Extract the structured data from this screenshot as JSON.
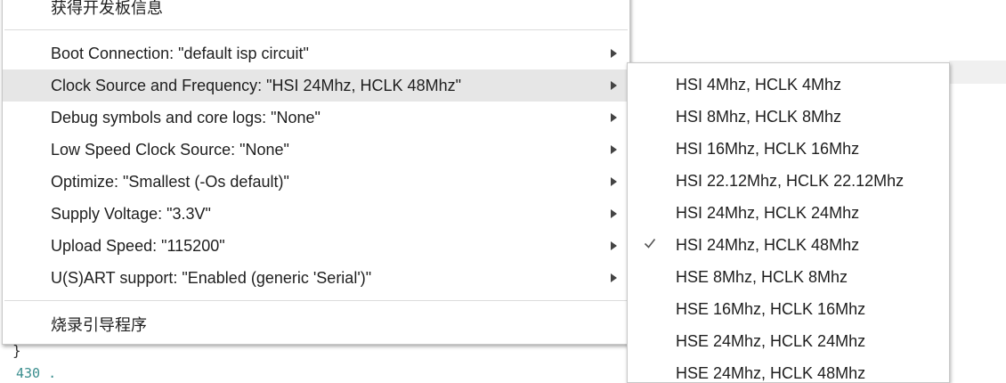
{
  "editor": {
    "closing_brace": "}",
    "partial_code": "430  ."
  },
  "menu": {
    "items": [
      {
        "label": "获得开发板信息",
        "has_submenu": false
      },
      {
        "label": "Boot Connection: \"default isp circuit\"",
        "has_submenu": true
      },
      {
        "label": "Clock Source and Frequency: \"HSI 24Mhz, HCLK 48Mhz\"",
        "has_submenu": true,
        "highlighted": true
      },
      {
        "label": "Debug symbols and core logs: \"None\"",
        "has_submenu": true
      },
      {
        "label": "Low Speed Clock Source: \"None\"",
        "has_submenu": true
      },
      {
        "label": "Optimize: \"Smallest (-Os default)\"",
        "has_submenu": true
      },
      {
        "label": "Supply Voltage: \"3.3V\"",
        "has_submenu": true
      },
      {
        "label": "Upload Speed: \"115200\"",
        "has_submenu": true
      },
      {
        "label": "U(S)ART support: \"Enabled (generic 'Serial')\"",
        "has_submenu": true
      },
      {
        "label": "烧录引导程序",
        "has_submenu": false
      }
    ]
  },
  "submenu": {
    "items": [
      {
        "label": "HSI 4Mhz, HCLK 4Mhz",
        "checked": false
      },
      {
        "label": "HSI 8Mhz, HCLK 8Mhz",
        "checked": false
      },
      {
        "label": "HSI 16Mhz, HCLK 16Mhz",
        "checked": false
      },
      {
        "label": "HSI 22.12Mhz, HCLK 22.12Mhz",
        "checked": false
      },
      {
        "label": "HSI 24Mhz, HCLK 24Mhz",
        "checked": false
      },
      {
        "label": "HSI 24Mhz, HCLK 48Mhz",
        "checked": true
      },
      {
        "label": "HSE 8Mhz, HCLK 8Mhz",
        "checked": false
      },
      {
        "label": "HSE 16Mhz, HCLK 16Mhz",
        "checked": false
      },
      {
        "label": "HSE 24Mhz, HCLK 24Mhz",
        "checked": false
      },
      {
        "label": "HSE 24Mhz, HCLK 48Mhz",
        "checked": false
      }
    ]
  },
  "colors": {
    "highlight": "#e6e6e6",
    "separator": "#dcdcdc",
    "text": "#1e1e1e"
  }
}
